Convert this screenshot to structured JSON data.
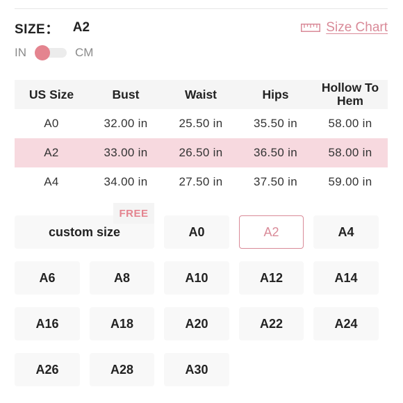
{
  "header": {
    "size_label": "SIZE：",
    "size_value": "A2",
    "size_chart_label": "Size Chart",
    "size_chart_icon": "ruler-icon",
    "accent_color": "#d98a98"
  },
  "units": {
    "left_label": "IN",
    "right_label": "CM",
    "selected": "IN"
  },
  "table": {
    "headers": [
      "US Size",
      "Bust",
      "Waist",
      "Hips",
      "Hollow To Hem"
    ],
    "rows": [
      [
        "A0",
        "32.00  in",
        "25.50  in",
        "35.50  in",
        "58.00  in"
      ],
      [
        "A2",
        "33.00  in",
        "26.50  in",
        "36.50  in",
        "58.00  in"
      ],
      [
        "A4",
        "34.00  in",
        "27.50  in",
        "37.50  in",
        "59.00  in"
      ]
    ],
    "highlighted_row": "A2"
  },
  "size_options": {
    "custom_label": "custom size",
    "free_badge": "FREE",
    "selected": "A2",
    "sizes": [
      "A0",
      "A2",
      "A4",
      "A6",
      "A8",
      "A10",
      "A12",
      "A14",
      "A16",
      "A18",
      "A20",
      "A22",
      "A24",
      "A26",
      "A28",
      "A30"
    ]
  }
}
